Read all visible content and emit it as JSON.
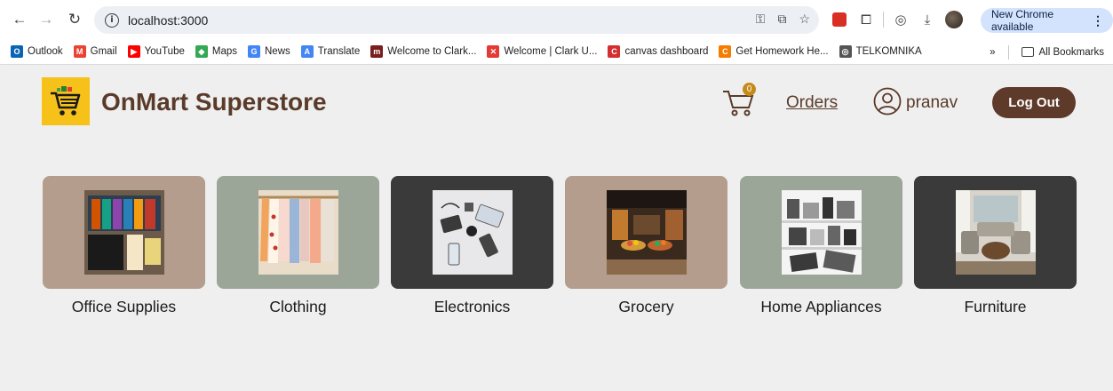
{
  "browser": {
    "url": "localhost:3000",
    "update_label": "New Chrome available",
    "bookmarks": [
      {
        "label": "Outlook",
        "color": "#0a64b4",
        "glyph": "O"
      },
      {
        "label": "Gmail",
        "color": "#ea4335",
        "glyph": "M"
      },
      {
        "label": "YouTube",
        "color": "#ff0000",
        "glyph": "▶"
      },
      {
        "label": "Maps",
        "color": "#34a853",
        "glyph": "◆"
      },
      {
        "label": "News",
        "color": "#4285f4",
        "glyph": "G"
      },
      {
        "label": "Translate",
        "color": "#4285f4",
        "glyph": "A"
      },
      {
        "label": "Welcome to Clark...",
        "color": "#7b1e1e",
        "glyph": "m"
      },
      {
        "label": "Welcome | Clark U...",
        "color": "#e53935",
        "glyph": "✕"
      },
      {
        "label": "canvas dashboard",
        "color": "#d32f2f",
        "glyph": "C"
      },
      {
        "label": "Get Homework He...",
        "color": "#f57c00",
        "glyph": "C"
      },
      {
        "label": "TELKOMNIKA",
        "color": "#555555",
        "glyph": "◎"
      }
    ],
    "overflow_label": "»",
    "all_bookmarks_label": "All Bookmarks"
  },
  "header": {
    "brand": "OnMart Superstore",
    "cart_count": "0",
    "orders_label": "Orders",
    "username": "pranav",
    "logout_label": "Log Out"
  },
  "categories": [
    {
      "label": "Office Supplies",
      "bg": "#b49d8c",
      "icon": "office-supplies-image"
    },
    {
      "label": "Clothing",
      "bg": "#9ba699",
      "icon": "clothing-image"
    },
    {
      "label": "Electronics",
      "bg": "#3a3a3a",
      "icon": "electronics-image"
    },
    {
      "label": "Grocery",
      "bg": "#b49d8c",
      "icon": "grocery-image"
    },
    {
      "label": "Home Appliances",
      "bg": "#9ba699",
      "icon": "home-appliances-image"
    },
    {
      "label": "Furniture",
      "bg": "#3a3a3a",
      "icon": "furniture-image"
    }
  ],
  "colors": {
    "brand_brown": "#5a3b2a",
    "logout_bg": "#5e3a2a",
    "logo_yellow": "#f6c21a",
    "badge": "#c68a1a"
  }
}
